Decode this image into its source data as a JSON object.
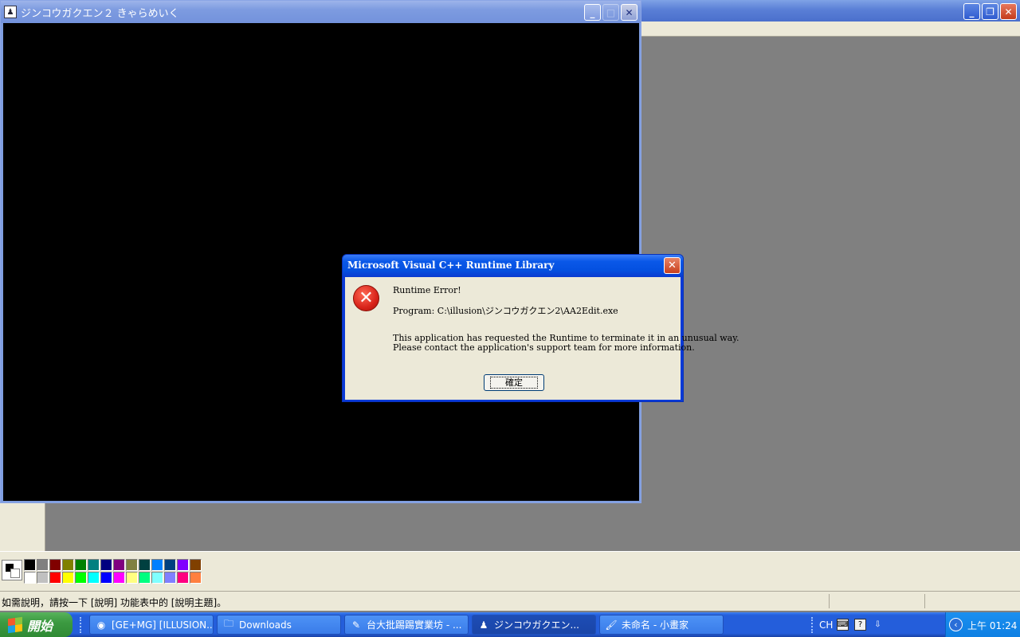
{
  "game_window": {
    "title": "ジンコウガクエン２ きゃらめいく",
    "icon": "game-app-icon"
  },
  "paint_window": {
    "status_text": "如需說明，請按一下 [說明] 功能表中的 [說明主題]。",
    "palette_top": [
      "#000000",
      "#808080",
      "#800000",
      "#808000",
      "#008000",
      "#008080",
      "#000080",
      "#800080",
      "#808040",
      "#004040",
      "#0080ff",
      "#004080",
      "#8000ff",
      "#804000"
    ],
    "palette_bottom": [
      "#ffffff",
      "#c0c0c0",
      "#ff0000",
      "#ffff00",
      "#00ff00",
      "#00ffff",
      "#0000ff",
      "#ff00ff",
      "#ffff80",
      "#00ff80",
      "#80ffff",
      "#8080ff",
      "#ff0080",
      "#ff8040"
    ]
  },
  "dialog": {
    "title": "Microsoft Visual C++ Runtime Library",
    "close_glyph": "✕",
    "line1": "Runtime Error!",
    "line2": "Program: C:\\illusion\\ジンコウガクエン2\\AA2Edit.exe",
    "line3": "This application has requested the Runtime to terminate it in an unusual way.",
    "line4": "Please contact the application's support team for more information.",
    "ok_label": "確定",
    "icon": "error-icon"
  },
  "taskbar": {
    "start_label": "開始",
    "buttons": [
      {
        "label": "[GE+MG] [ILLUSION...",
        "icon": "chrome-icon"
      },
      {
        "label": "Downloads",
        "icon": "folder-icon"
      },
      {
        "label": "台大批踢踢實業坊 - ...",
        "icon": "pcman-icon"
      },
      {
        "label": "ジンコウガクエン...",
        "icon": "game-app-icon"
      },
      {
        "label": "未命名 - 小畫家",
        "icon": "paint-icon"
      }
    ],
    "lang": "CH",
    "clock": "上午 01:24"
  }
}
